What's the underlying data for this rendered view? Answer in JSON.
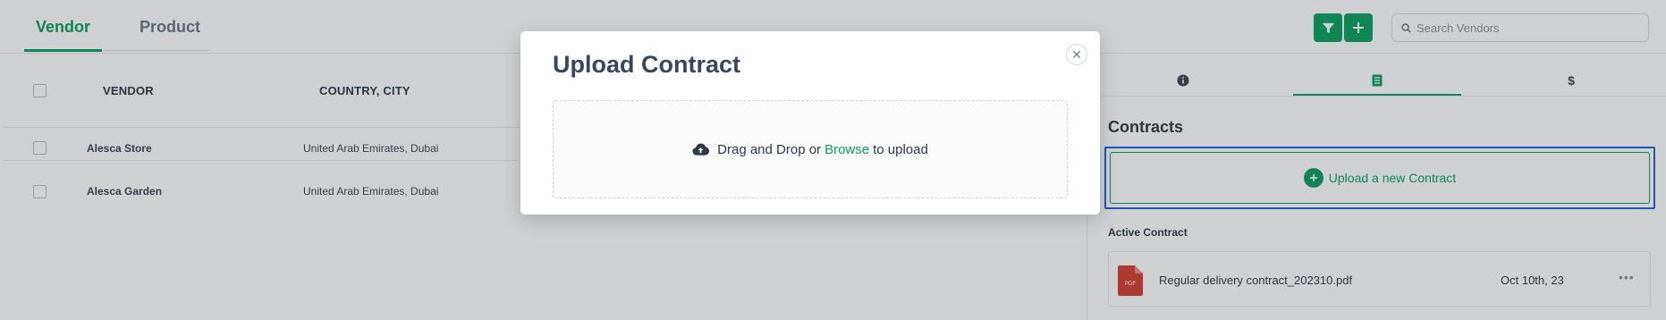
{
  "tabs": {
    "vendor": "Vendor",
    "product": "Product"
  },
  "search": {
    "placeholder": "Search Vendors"
  },
  "table": {
    "headers": {
      "vendor": "VENDOR",
      "location": "COUNTRY, CITY"
    },
    "rows": [
      {
        "vendor": "Alesca Store",
        "location": "United Arab Emirates, Dubai"
      },
      {
        "vendor": "Alesca Garden",
        "location": "United Arab Emirates, Dubai"
      }
    ]
  },
  "side_panel": {
    "tab_icons": [
      "info-icon",
      "document-icon",
      "dollar-icon"
    ],
    "contracts_title": "Contracts",
    "upload_new_label": "Upload a new Contract",
    "active_contract_title": "Active Contract",
    "contract": {
      "file_name": "Regular delivery contract_202310.pdf",
      "date": "Oct 10th, 23",
      "file_type": "PDF"
    }
  },
  "modal": {
    "title": "Upload Contract",
    "dropzone": {
      "prefix": "Drag and Drop or",
      "link": "Browse",
      "suffix": "to upload"
    }
  },
  "colors": {
    "accent": "#0aa15d",
    "focus_ring": "#1663e0",
    "overlay": "rgba(35,42,50,0.22)"
  }
}
